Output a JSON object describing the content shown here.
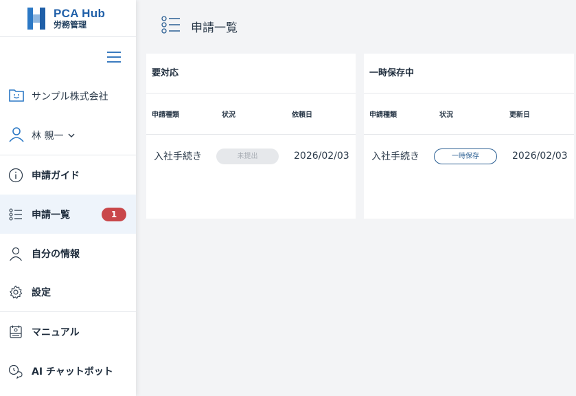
{
  "app": {
    "logo_title": "PCA Hub",
    "logo_subtitle": "労務管理"
  },
  "sidebar": {
    "company": "サンプル株式会社",
    "user": "林 親一",
    "items": [
      {
        "label": "申請ガイド",
        "icon": "info-icon"
      },
      {
        "label": "申請一覧",
        "icon": "list-icon",
        "badge": "1",
        "active": true
      },
      {
        "label": "自分の情報",
        "icon": "person-icon"
      },
      {
        "label": "設定",
        "icon": "gear-icon"
      },
      {
        "label": "マニュアル",
        "icon": "manual-icon"
      },
      {
        "label": "AI チャットボット",
        "icon": "chatbot-icon"
      }
    ]
  },
  "page": {
    "title": "申請一覧"
  },
  "cards": {
    "action": {
      "title": "要対応",
      "headers": [
        "申請種類",
        "状況",
        "依頼日"
      ],
      "rows": [
        {
          "type": "入社手続き",
          "status": "未提出",
          "date": "2026/02/03"
        }
      ]
    },
    "draft": {
      "title": "一時保存中",
      "headers": [
        "申請種類",
        "状況",
        "更新日"
      ],
      "rows": [
        {
          "type": "入社手続き",
          "status": "一時保存",
          "date": "2026/02/03"
        }
      ]
    }
  },
  "colors": {
    "accent": "#1f5fa8",
    "badge": "#c9474a",
    "active_bg": "#eef4fb",
    "page_bg": "#f3f4f6"
  }
}
